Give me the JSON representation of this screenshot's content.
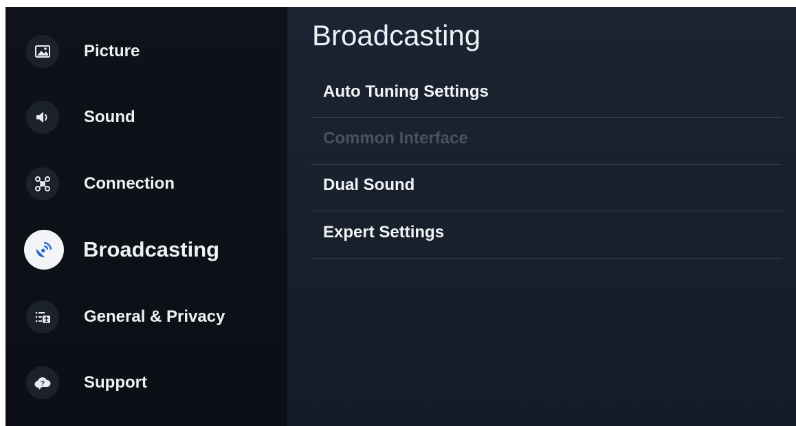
{
  "sidebar": {
    "items": [
      {
        "label": "Picture",
        "icon": "picture-icon"
      },
      {
        "label": "Sound",
        "icon": "speaker-icon"
      },
      {
        "label": "Connection",
        "icon": "network-icon"
      },
      {
        "label": "Broadcasting",
        "icon": "satellite-dish-icon",
        "active": true
      },
      {
        "label": "General & Privacy",
        "icon": "general-privacy-icon"
      },
      {
        "label": "Support",
        "icon": "support-cloud-icon"
      }
    ]
  },
  "main": {
    "title": "Broadcasting",
    "menu": [
      {
        "label": "Auto Tuning Settings",
        "enabled": true
      },
      {
        "label": "Common Interface",
        "enabled": false
      },
      {
        "label": "Dual Sound",
        "enabled": true
      },
      {
        "label": "Expert Settings",
        "enabled": true
      }
    ]
  },
  "colors": {
    "accent": "#2a68c9",
    "disabled_text": "#4a5260",
    "background": "#151c27"
  }
}
